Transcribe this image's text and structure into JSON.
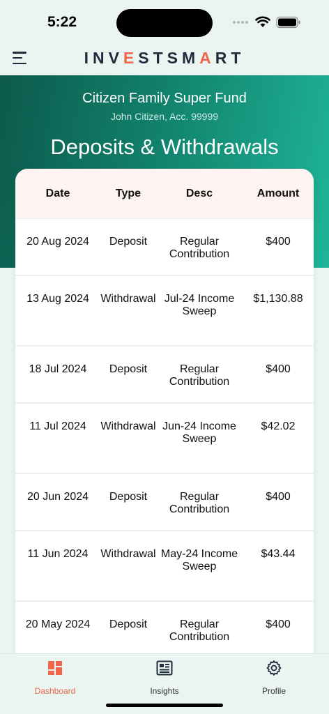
{
  "status_bar": {
    "time": "5:22"
  },
  "header": {
    "logo_parts": [
      "INV",
      "E",
      "STSM",
      "A",
      "RT"
    ]
  },
  "hero": {
    "fund_name": "Citizen Family Super Fund",
    "account_line": "John Citizen, Acc. 99999",
    "title": "Deposits & Withdrawals"
  },
  "table": {
    "columns": [
      "Date",
      "Type",
      "Desc",
      "Amount"
    ],
    "rows": [
      {
        "date": "20 Aug 2024",
        "type": "Deposit",
        "desc": "Regular Contribution",
        "amount": "$400"
      },
      {
        "date": "13 Aug 2024",
        "type": "Withdrawal",
        "desc": "Jul-24 Income Sweep",
        "amount": "$1,130.88"
      },
      {
        "date": "18 Jul 2024",
        "type": "Deposit",
        "desc": "Regular Contribution",
        "amount": "$400"
      },
      {
        "date": "11 Jul 2024",
        "type": "Withdrawal",
        "desc": "Jun-24 Income Sweep",
        "amount": "$42.02"
      },
      {
        "date": "20 Jun 2024",
        "type": "Deposit",
        "desc": "Regular Contribution",
        "amount": "$400"
      },
      {
        "date": "11 Jun 2024",
        "type": "Withdrawal",
        "desc": "May-24 Income Sweep",
        "amount": "$43.44"
      },
      {
        "date": "20 May 2024",
        "type": "Deposit",
        "desc": "Regular Contribution",
        "amount": "$400"
      }
    ]
  },
  "bottom_nav": {
    "items": [
      {
        "label": "Dashboard",
        "icon": "dashboard-icon",
        "active": true
      },
      {
        "label": "Insights",
        "icon": "insights-icon",
        "active": false
      },
      {
        "label": "Profile",
        "icon": "gear-icon",
        "active": false
      }
    ]
  },
  "colors": {
    "accent": "#f0654c",
    "hero_start": "#0d5a4c",
    "hero_end": "#1fb598",
    "background": "#eaf4f1"
  }
}
